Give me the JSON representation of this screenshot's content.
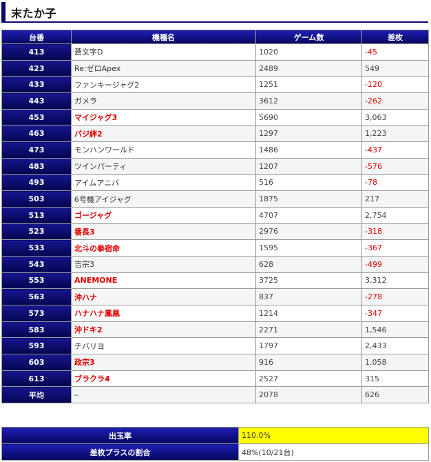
{
  "page": {
    "title": "末たか子"
  },
  "table": {
    "headers": {
      "machine_no": "台番",
      "name": "機種名",
      "games": "ゲーム数",
      "diff": "差枚"
    },
    "rows": [
      {
        "no": "413",
        "name": "蒼文字D",
        "games": "1020",
        "diff": "-45",
        "highlight": false,
        "negative": true
      },
      {
        "no": "423",
        "name": "Re:ゼロApex",
        "games": "2489",
        "diff": "549",
        "highlight": false,
        "negative": false
      },
      {
        "no": "433",
        "name": "ファンキージャグ2",
        "games": "1251",
        "diff": "-120",
        "highlight": false,
        "negative": true
      },
      {
        "no": "443",
        "name": "ガメラ",
        "games": "3612",
        "diff": "-262",
        "highlight": false,
        "negative": true
      },
      {
        "no": "453",
        "name": "マイジャグ3",
        "games": "5690",
        "diff": "3,063",
        "highlight": true,
        "negative": false
      },
      {
        "no": "463",
        "name": "バジ絆2",
        "games": "1297",
        "diff": "1,223",
        "highlight": true,
        "negative": false
      },
      {
        "no": "473",
        "name": "モンハンワールド",
        "games": "1486",
        "diff": "-437",
        "highlight": false,
        "negative": true
      },
      {
        "no": "483",
        "name": "ツインパーティ",
        "games": "1207",
        "diff": "-576",
        "highlight": false,
        "negative": true
      },
      {
        "no": "493",
        "name": "アイムアニバ",
        "games": "516",
        "diff": "-78",
        "highlight": false,
        "negative": true
      },
      {
        "no": "503",
        "name": "6号機アイジャグ",
        "games": "1875",
        "diff": "217",
        "highlight": false,
        "negative": false
      },
      {
        "no": "513",
        "name": "ゴージャグ",
        "games": "4707",
        "diff": "2,754",
        "highlight": true,
        "negative": false
      },
      {
        "no": "523",
        "name": "番長3",
        "games": "2976",
        "diff": "-318",
        "highlight": true,
        "negative": true
      },
      {
        "no": "533",
        "name": "北斗の拳宿命",
        "games": "1595",
        "diff": "-367",
        "highlight": true,
        "negative": true
      },
      {
        "no": "543",
        "name": "吉宗3",
        "games": "628",
        "diff": "-499",
        "highlight": false,
        "negative": true
      },
      {
        "no": "553",
        "name": "ANEMONE",
        "games": "3725",
        "diff": "3,312",
        "highlight": true,
        "negative": false
      },
      {
        "no": "563",
        "name": "沖ハナ",
        "games": "837",
        "diff": "-278",
        "highlight": true,
        "negative": true
      },
      {
        "no": "573",
        "name": "ハナハナ鳳凰",
        "games": "1214",
        "diff": "-347",
        "highlight": true,
        "negative": true
      },
      {
        "no": "583",
        "name": "沖ドキ2",
        "games": "2271",
        "diff": "1,546",
        "highlight": true,
        "negative": false
      },
      {
        "no": "593",
        "name": "チバリヨ",
        "games": "1797",
        "diff": "2,433",
        "highlight": false,
        "negative": false
      },
      {
        "no": "603",
        "name": "政宗3",
        "games": "916",
        "diff": "1,058",
        "highlight": true,
        "negative": false
      },
      {
        "no": "613",
        "name": "ブラクラ4",
        "games": "2527",
        "diff": "315",
        "highlight": true,
        "negative": false
      },
      {
        "no": "平均",
        "name": "–",
        "games": "2078",
        "diff": "626",
        "highlight": false,
        "negative": false
      }
    ]
  },
  "summary": {
    "payout_label": "出玉率",
    "payout_value": "110.0%",
    "plus_ratio_label": "差枚プラスの割合",
    "plus_ratio_value": "48%(10/21台)"
  }
}
